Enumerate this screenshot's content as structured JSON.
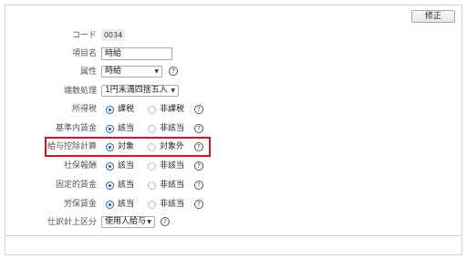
{
  "edit_button": "修正",
  "fields": {
    "code": {
      "label": "コード",
      "value": "0034"
    },
    "item_name": {
      "label": "項目名",
      "value": "時給"
    },
    "attribute": {
      "label": "属性",
      "value": "時給"
    },
    "rounding": {
      "label": "端数処理",
      "value": "1円未満四捨五入"
    },
    "income_tax": {
      "label": "所得税",
      "options": [
        "課税",
        "非課税"
      ],
      "selected": "課税"
    },
    "standard_wage": {
      "label": "基準内賃金",
      "options": [
        "該当",
        "非該当"
      ],
      "selected": "該当"
    },
    "salary_deduction": {
      "label": "給与控除計算",
      "options": [
        "対象",
        "対象外"
      ],
      "selected": "対象"
    },
    "social_insurance": {
      "label": "社保報酬",
      "options": [
        "該当",
        "非該当"
      ],
      "selected": "該当"
    },
    "fixed_wage": {
      "label": "固定的賃金",
      "options": [
        "該当",
        "非該当"
      ],
      "selected": "該当"
    },
    "labor_insurance": {
      "label": "労保賃金",
      "options": [
        "該当",
        "非該当"
      ],
      "selected": "該当"
    },
    "journal_category": {
      "label": "仕訳計上区分",
      "value": "使用人給与"
    }
  },
  "help_glyph": "?",
  "caret": "▼",
  "colors": {
    "radio_selected": "#1a5fb4",
    "highlight_border": "#e0101a"
  }
}
